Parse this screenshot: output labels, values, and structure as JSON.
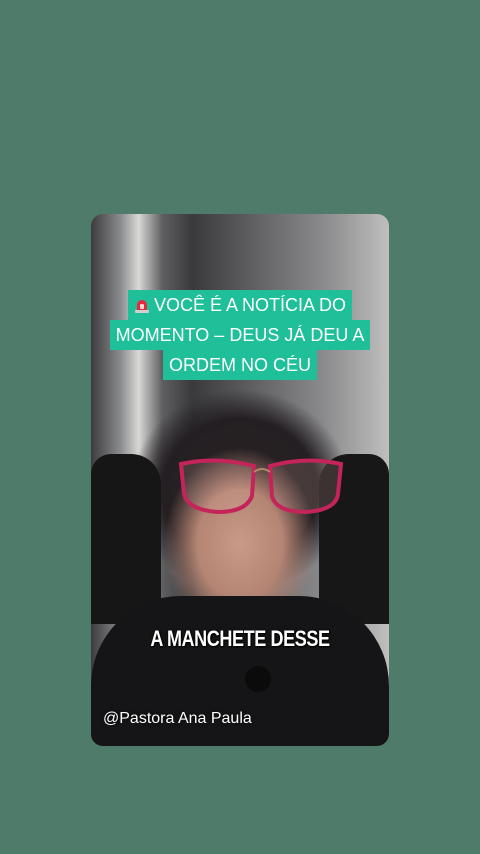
{
  "video": {
    "caption_lines": [
      "VOCÊ É A NOTÍCIA DO",
      "MOMENTO – DEUS JÁ DEU A",
      "ORDEM NO CÉU"
    ],
    "caption_icon": "police-siren-icon",
    "subtitle": "A MANCHETE DESSE",
    "watermark": "@Pastora Ana Paula"
  },
  "colors": {
    "page_background": "#4f7b6a",
    "caption_background": "#1fbf9a"
  }
}
